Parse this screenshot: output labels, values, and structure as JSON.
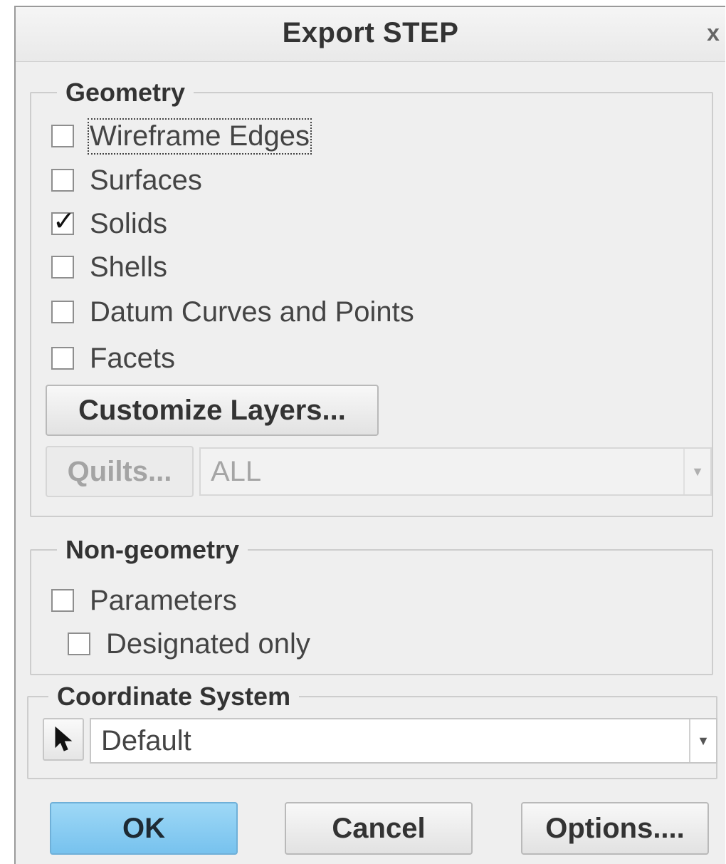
{
  "dialog": {
    "title": "Export STEP",
    "close_glyph": "x"
  },
  "geometry": {
    "legend": "Geometry",
    "options": [
      {
        "label": "Wireframe Edges",
        "checked": false,
        "focused": true
      },
      {
        "label": "Surfaces",
        "checked": false
      },
      {
        "label": "Solids",
        "checked": true
      },
      {
        "label": "Shells",
        "checked": false
      },
      {
        "label": "Datum Curves and Points",
        "checked": false
      },
      {
        "label": "Facets",
        "checked": false
      }
    ],
    "customize_layers_label": "Customize Layers...",
    "quilts_label": "Quilts...",
    "quilts_value": "ALL"
  },
  "non_geometry": {
    "legend": "Non-geometry",
    "parameters_label": "Parameters",
    "parameters_checked": false,
    "designated_only_label": "Designated only",
    "designated_only_checked": false
  },
  "coordinate_system": {
    "legend": "Coordinate System",
    "value": "Default",
    "pick_icon": "cursor-arrow-icon"
  },
  "buttons": {
    "ok": "OK",
    "cancel": "Cancel",
    "options": "Options...."
  },
  "colors": {
    "ok_button": "#8ecff3",
    "dialog_bg": "#efefef"
  }
}
